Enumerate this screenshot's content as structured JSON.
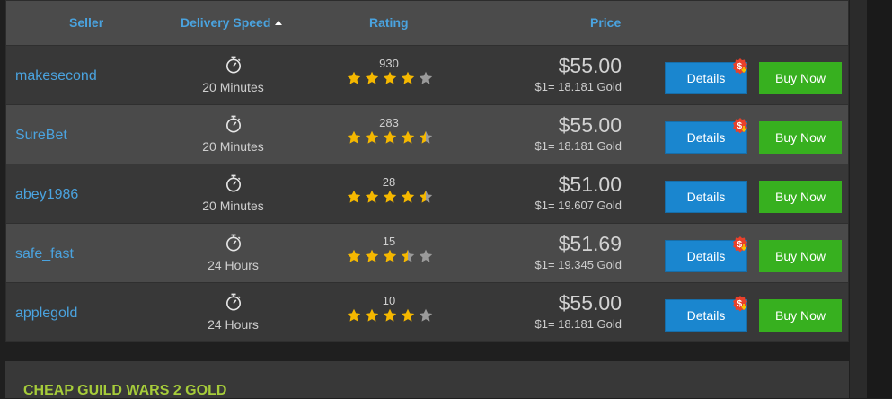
{
  "header": {
    "seller": "Seller",
    "delivery_speed": "Delivery Speed",
    "rating": "Rating",
    "price": "Price"
  },
  "rows": [
    {
      "seller": "makesecond",
      "speed": "20 Minutes",
      "rating_count": "930",
      "stars": 4,
      "price": "$55.00",
      "rate": "$1= 18.181 Gold",
      "details_label": "Details",
      "buy_label": "Buy Now",
      "promo": true
    },
    {
      "seller": "SureBet",
      "speed": "20 Minutes",
      "rating_count": "283",
      "stars": 4.5,
      "price": "$55.00",
      "rate": "$1= 18.181 Gold",
      "details_label": "Details",
      "buy_label": "Buy Now",
      "promo": true
    },
    {
      "seller": "abey1986",
      "speed": "20 Minutes",
      "rating_count": "28",
      "stars": 4.5,
      "price": "$51.00",
      "rate": "$1= 19.607 Gold",
      "details_label": "Details",
      "buy_label": "Buy Now",
      "promo": false
    },
    {
      "seller": "safe_fast",
      "speed": "24 Hours",
      "rating_count": "15",
      "stars": 3.5,
      "price": "$51.69",
      "rate": "$1= 19.345 Gold",
      "details_label": "Details",
      "buy_label": "Buy Now",
      "promo": true
    },
    {
      "seller": "applegold",
      "speed": "24 Hours",
      "rating_count": "10",
      "stars": 4,
      "price": "$55.00",
      "rate": "$1= 18.181 Gold",
      "details_label": "Details",
      "buy_label": "Buy Now",
      "promo": true
    }
  ],
  "promo_label": "$",
  "section_title": "CHEAP GUILD WARS 2 GOLD",
  "colors": {
    "accent_link": "#4aa3df",
    "details_button": "#1a86cf",
    "buy_button": "#37b01f",
    "star_filled": "#f5b800",
    "star_empty": "#9a9a9a",
    "section_title": "#a6cc3a"
  },
  "icons": {
    "speed": "stopwatch-icon",
    "rating": "star-icon",
    "promo": "discount-badge-icon",
    "sort": "sort-ascending-icon"
  }
}
